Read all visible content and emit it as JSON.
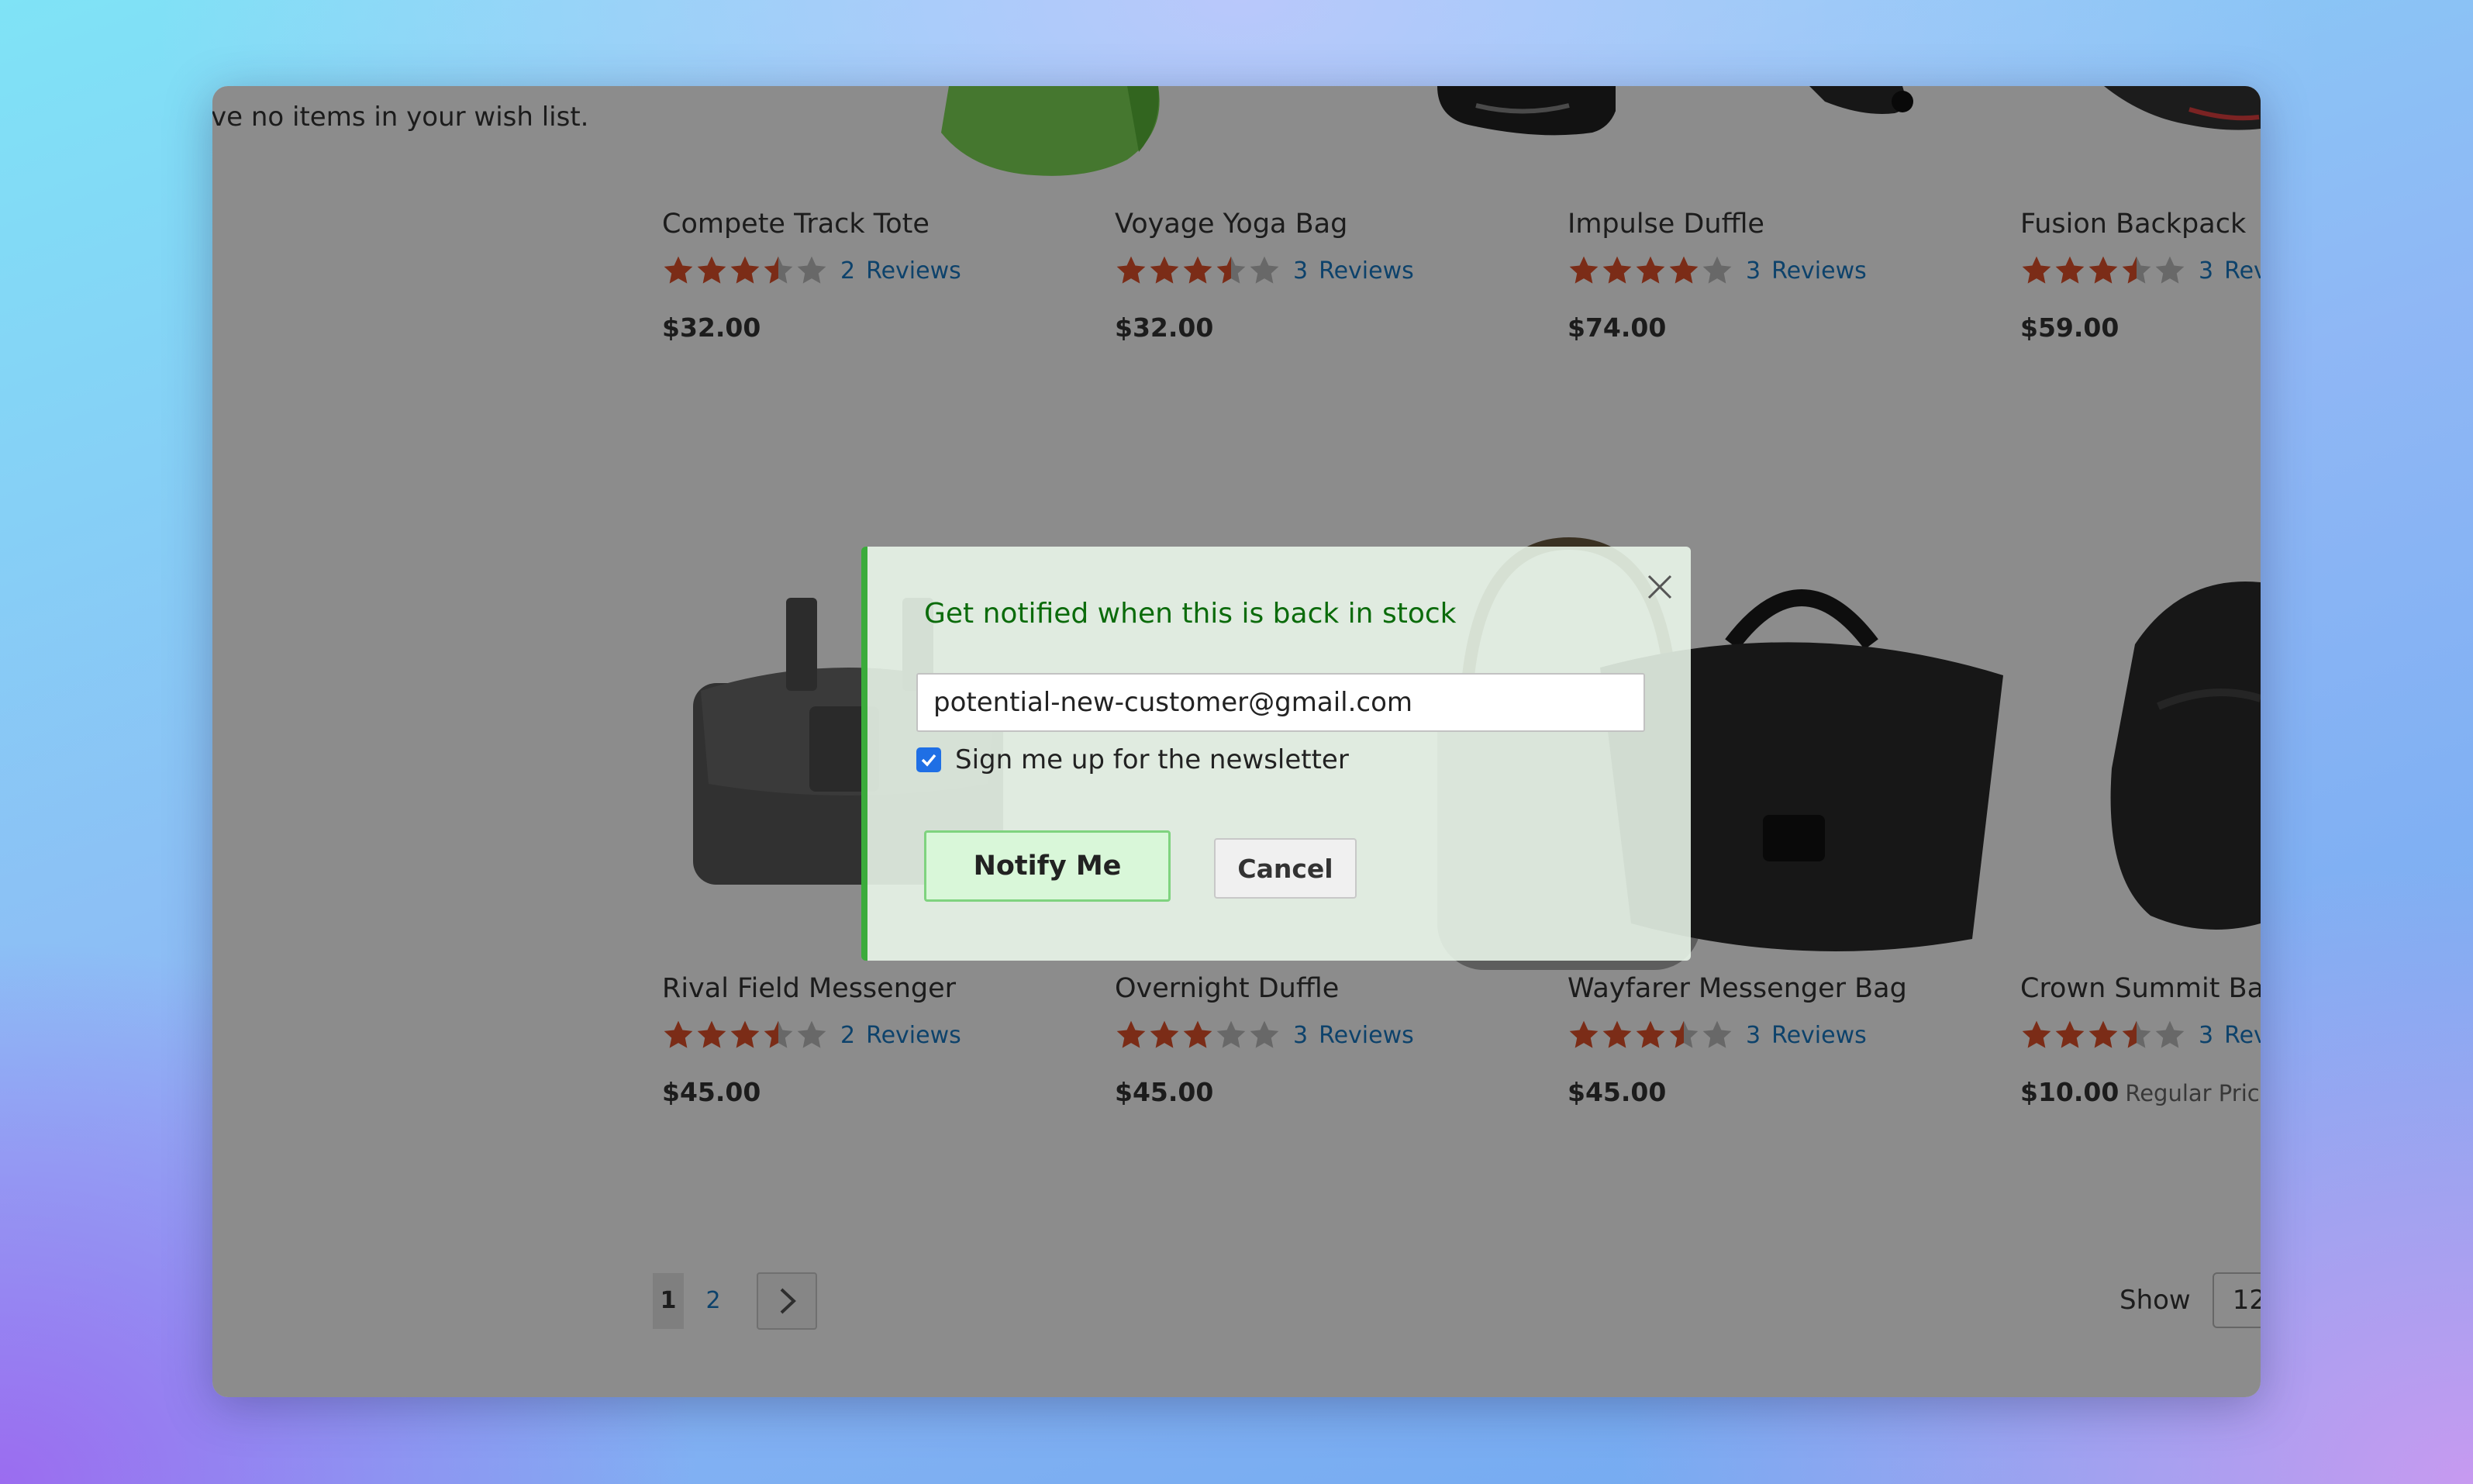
{
  "wishlist_text": "ve no items in your wish list.",
  "products": [
    {
      "name": "Compete Track Tote",
      "rating": 3.5,
      "review_count": "2",
      "review_label": "Reviews",
      "price": "$32.00"
    },
    {
      "name": "Voyage Yoga Bag",
      "rating": 3.5,
      "review_count": "3",
      "review_label": "Reviews",
      "price": "$32.00"
    },
    {
      "name": "Impulse Duffle",
      "rating": 4,
      "review_count": "3",
      "review_label": "Reviews",
      "price": "$74.00"
    },
    {
      "name": "Fusion Backpack",
      "rating": 3.5,
      "review_count": "3",
      "review_label": "Rev",
      "price": "$59.00"
    },
    {
      "name": "Rival Field Messenger",
      "rating": 3.5,
      "review_count": "2",
      "review_label": "Reviews",
      "price": "$45.00"
    },
    {
      "name": "Overnight Duffle",
      "rating": 3,
      "review_count": "3",
      "review_label": "Reviews",
      "price": "$45.00"
    },
    {
      "name": "Wayfarer Messenger Bag",
      "rating": 3.5,
      "review_count": "3",
      "review_label": "Reviews",
      "price": "$45.00"
    },
    {
      "name": "Crown Summit Back",
      "rating": 3.5,
      "review_count": "3",
      "review_label": "Rev",
      "price": "$10.00",
      "regular_price_label": "Regular Price $"
    }
  ],
  "pagination": {
    "current": "1",
    "next_page": "2",
    "next_icon": "chevron-right-icon"
  },
  "toolbar": {
    "show_label": "Show",
    "limit_value": "12"
  },
  "modal": {
    "title": "Get notified when this is back in stock",
    "email_value": "potential-new-customer@gmail.com",
    "newsletter_label": "Sign me up for the newsletter",
    "newsletter_checked": true,
    "notify_label": "Notify Me",
    "cancel_label": "Cancel",
    "close_icon": "close-icon"
  },
  "colors": {
    "star_filled": "#e0512a",
    "star_empty": "#bdbdbd",
    "link": "#1979c3",
    "modal_accent": "#3bab3b",
    "modal_title": "#0b6b0b"
  }
}
